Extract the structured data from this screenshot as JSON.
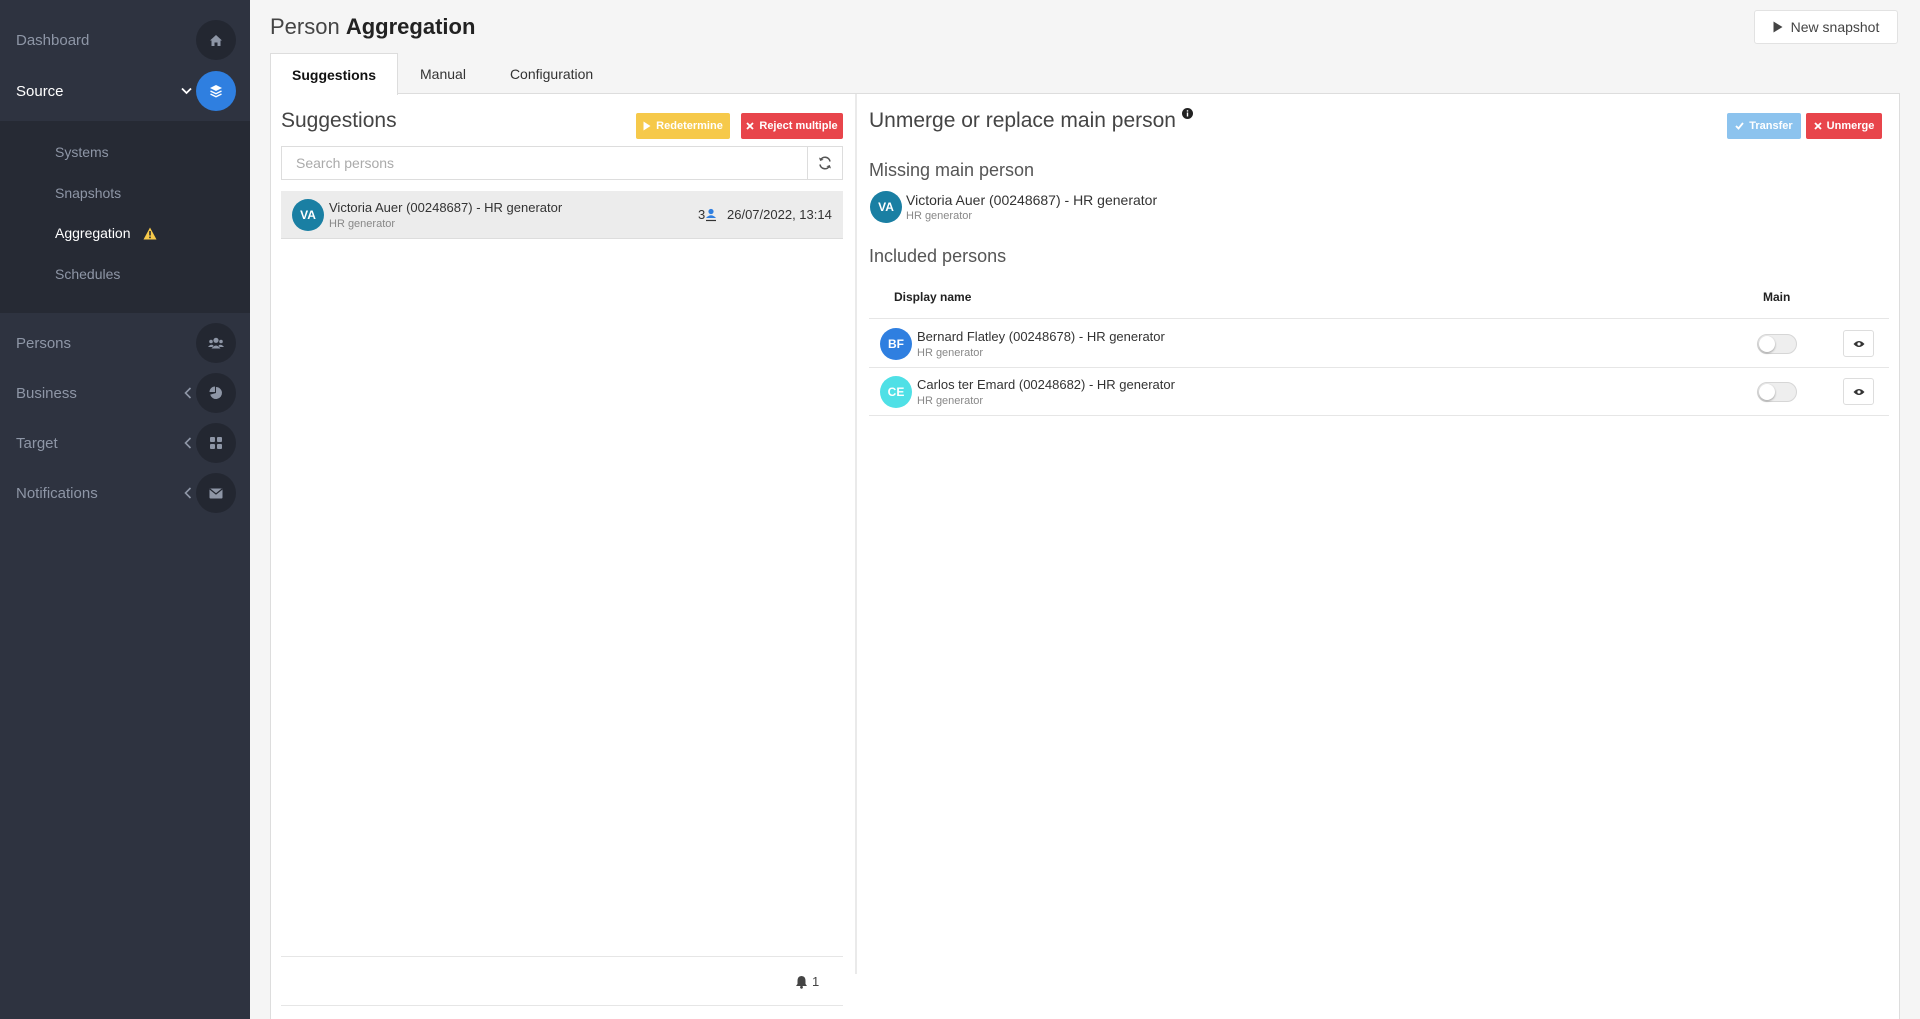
{
  "sidebar": {
    "dashboard": "Dashboard",
    "source": "Source",
    "sub_items": [
      "Systems",
      "Snapshots",
      "Aggregation",
      "Schedules"
    ],
    "persons": "Persons",
    "business": "Business",
    "target": "Target",
    "notifications": "Notifications"
  },
  "header": {
    "title_prefix": "Person",
    "title_bold": "Aggregation",
    "new_snapshot": "New snapshot"
  },
  "tabs": [
    "Suggestions",
    "Manual",
    "Configuration"
  ],
  "suggestions": {
    "title": "Suggestions",
    "redetermine": "Redetermine",
    "reject_multiple": "Reject multiple",
    "search_placeholder": "Search persons",
    "items": [
      {
        "initials": "VA",
        "name": "Victoria Auer (00248687) - HR generator",
        "sub": "HR generator",
        "count": "3",
        "date": "26/07/2022, 13:14",
        "color": "#1a7fa3"
      }
    ],
    "footer_count": "1"
  },
  "right": {
    "title": "Unmerge or replace main person",
    "transfer": "Transfer",
    "unmerge": "Unmerge",
    "missing_title": "Missing main person",
    "missing_person": {
      "initials": "VA",
      "name": "Victoria Auer (00248687) - HR generator",
      "sub": "HR generator",
      "color": "#1a7fa3"
    },
    "included_title": "Included persons",
    "col_display_name": "Display name",
    "col_main": "Main",
    "included": [
      {
        "initials": "BF",
        "name": "Bernard Flatley (00248678) - HR generator",
        "sub": "HR generator",
        "color": "#2f7fe0",
        "main": false
      },
      {
        "initials": "CE",
        "name": "Carlos ter Emard (00248682) - HR generator",
        "sub": "HR generator",
        "color": "#4fe0e6",
        "main": false
      }
    ]
  }
}
